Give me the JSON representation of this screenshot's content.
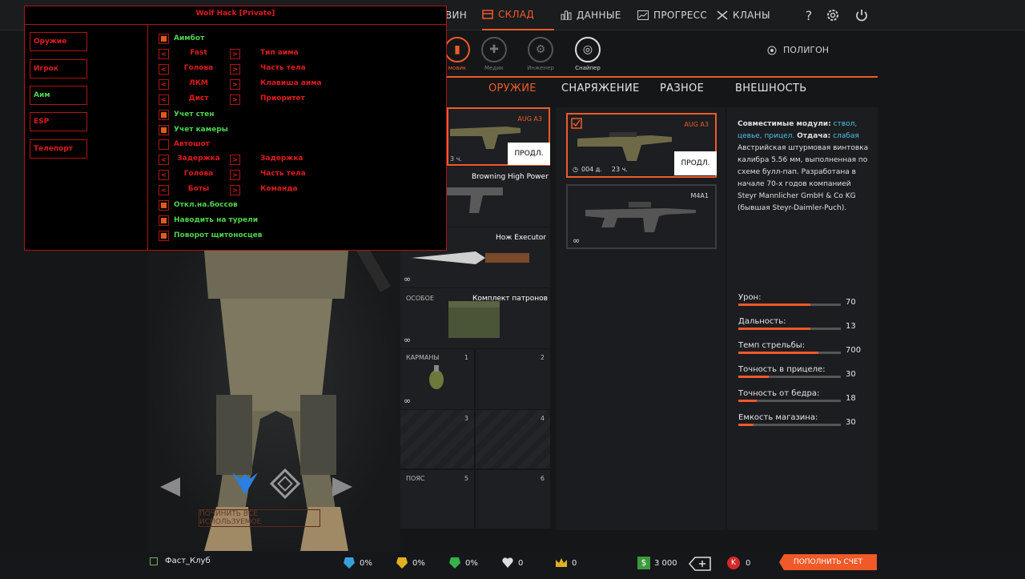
{
  "topbar": {
    "partial_item": "ВИН",
    "items": [
      "СКЛАД",
      "ДАННЫЕ",
      "ПРОГРЕСС",
      "КЛАНЫ"
    ],
    "help": "?"
  },
  "classes": {
    "partial": "мовик",
    "medic": "Медик",
    "engineer": "Инженер",
    "sniper": "Снайпер"
  },
  "polygon": "ПОЛИГОН",
  "tabs": [
    "ОРУЖИЕ",
    "СНАРЯЖЕНИЕ",
    "РАЗНОЕ",
    "ВНЕШНОСТЬ"
  ],
  "slots": {
    "primary": {
      "name": "AUG A3",
      "time": "3 ч.",
      "renew": "ПРОДЛ."
    },
    "pistol": {
      "name": "Browning High Power"
    },
    "knife": {
      "name": "Нож Executor",
      "inf": "∞"
    },
    "special": {
      "label": "ОСОБОЕ",
      "name": "Комплект патронов",
      "inf": "∞"
    },
    "pockets": {
      "label": "КАРМАНЫ",
      "n1": "1",
      "n2": "2",
      "n3": "3",
      "n4": "4",
      "inf": "∞"
    },
    "belt": {
      "label": "ПОЯС",
      "n5": "5",
      "n6": "6"
    }
  },
  "cards": {
    "aug": {
      "name": "AUG A3",
      "days": "004 д.",
      "hours": "23 ч.",
      "renew": "ПРОДЛ."
    },
    "m4": {
      "name": "M4A1",
      "inf": "∞"
    }
  },
  "info": {
    "modules_label": "Совместимые модули:",
    "modules": "ствол, цевье, прицел.",
    "recoil_label": "Отдача:",
    "recoil": "слабая",
    "desc": "Австрийская штурмовая винтовка калибра 5.56 мм, выполненная по схеме булл-пап. Разработана в начале 70-х годов компанией Steyr Mannlicher GmbH & Co KG (бывшая Steyr-Daimler-Puch).",
    "stats": [
      {
        "label": "Урон:",
        "value": "70",
        "fill": 0.7
      },
      {
        "label": "Дальность:",
        "value": "13",
        "fill": 0.7
      },
      {
        "label": "Темп стрельбы:",
        "value": "700",
        "fill": 0.78
      },
      {
        "label": "Точность в прицеле:",
        "value": "30",
        "fill": 0.3
      },
      {
        "label": "Точность от бедра:",
        "value": "18",
        "fill": 0.18
      },
      {
        "label": "Емкость магазина:",
        "value": "30",
        "fill": 0.15
      }
    ]
  },
  "repair": "ПОЧИНИТЬ ВСЕ ИСПОЛЬЗУЕМОЕ",
  "bottombar": {
    "clan": "Фаст_Клуб",
    "boost1": "0%",
    "boost2": "0%",
    "boost3": "0%",
    "hearts": "0",
    "crowns": "0",
    "money": "3 000",
    "kredits": "0",
    "topup": "ПОПОЛНИТЬ СЧЕТ"
  },
  "hack": {
    "title": "Wolf Hack [Private]",
    "categories": [
      "Оружие",
      "Игрок",
      "Аим",
      "ESP",
      "Телепорт"
    ],
    "aimbot": "Аимбот",
    "rows1": [
      {
        "value": "Fast",
        "option": "Тип аима"
      },
      {
        "value": "Голова",
        "option": "Часть тела"
      },
      {
        "value": "ЛКМ",
        "option": "Клавиша аима"
      },
      {
        "value": "Дист",
        "option": "Приоритет"
      }
    ],
    "walls": "Учет стен",
    "camera": "Учет камеры",
    "autoshot": "Автошот",
    "rows2": [
      {
        "value": "Задержка",
        "option": "Задержка"
      },
      {
        "value": "Голова",
        "option": "Часть тела"
      },
      {
        "value": "Боты",
        "option": "Команда"
      }
    ],
    "bosses": "Откл.на.боссов",
    "turrets": "Наводить на турели",
    "shields": "Поворот щитоносцев",
    "arrow_left": "<",
    "arrow_right": ">"
  },
  "colors": {
    "accent": "#f05a28",
    "hack_red": "#e21b1b",
    "hack_green": "#4fd34f",
    "info_cyan": "#4fc3e8"
  }
}
